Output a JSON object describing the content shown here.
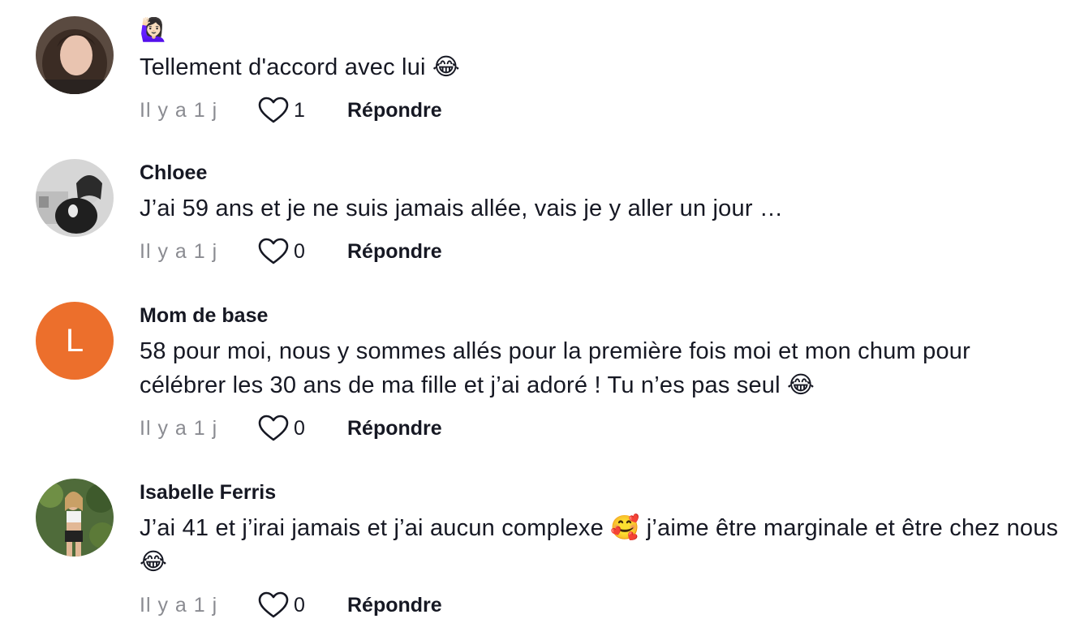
{
  "comments": [
    {
      "username": "",
      "username_emoji": "🙋🏻‍♀️",
      "text": "Tellement d'accord avec lui 😂",
      "time": "Il y a 1 j",
      "likes": "1",
      "reply_label": "Répondre"
    },
    {
      "username": "Chloee",
      "text": "J’ai 59 ans et je ne suis jamais allée, vais je y aller un jour …",
      "time": "Il y a 1 j",
      "likes": "0",
      "reply_label": "Répondre"
    },
    {
      "username": "Mom de base",
      "avatar_letter": "L",
      "avatar_color": "#ec6f2c",
      "text": "58 pour moi, nous y sommes allés pour la première fois moi et mon chum pour célébrer les 30 ans de ma fille et j’ai adoré ! Tu n’es pas seul 😂",
      "time": "Il y a 1 j",
      "likes": "0",
      "reply_label": "Répondre"
    },
    {
      "username": "Isabelle Ferris",
      "text": "J’ai 41 et j’irai jamais et j’ai aucun complexe 🥰 j’aime être marginale et être chez nous 😂",
      "time": "Il y a 1 j",
      "likes": "0",
      "reply_label": "Répondre"
    }
  ],
  "icons": {
    "like": "heart-outline-icon"
  }
}
